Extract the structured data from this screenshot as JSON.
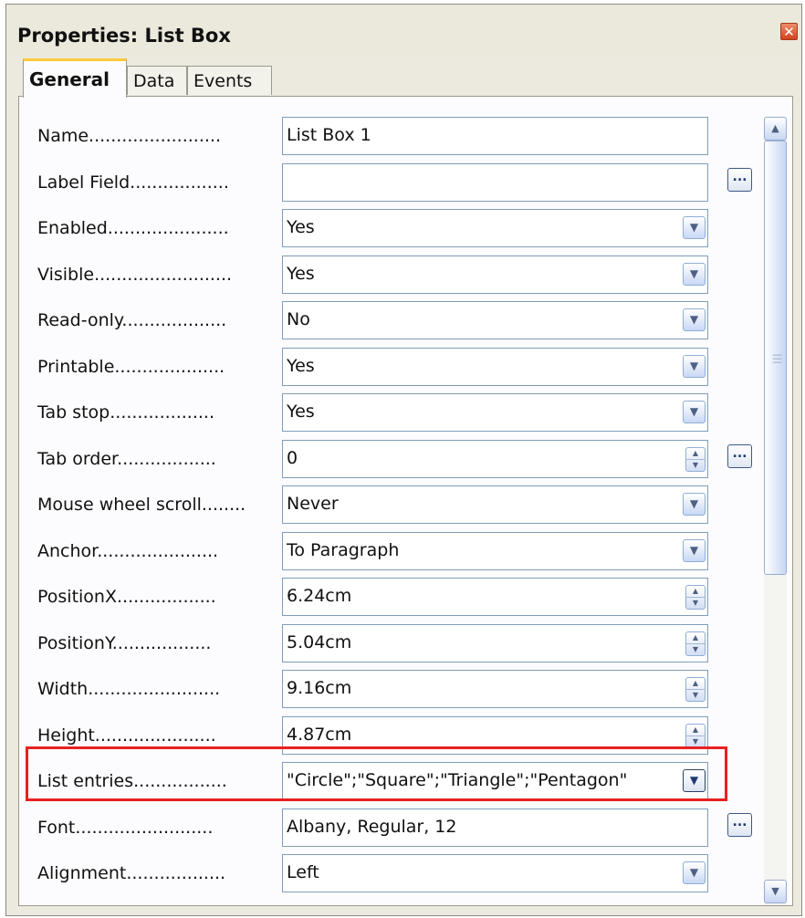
{
  "window": {
    "title": "Properties: List Box"
  },
  "tabs": [
    {
      "label": "General",
      "active": true
    },
    {
      "label": "Data",
      "active": false
    },
    {
      "label": "Events",
      "active": false
    }
  ],
  "properties": [
    {
      "label": "Name........................",
      "value": "List Box 1",
      "control": "text"
    },
    {
      "label": "Label Field..................",
      "value": "",
      "control": "text-ellipsis"
    },
    {
      "label": "Enabled......................",
      "value": "Yes",
      "control": "dropdown"
    },
    {
      "label": "Visible.........................",
      "value": "Yes",
      "control": "dropdown"
    },
    {
      "label": "Read-only...................",
      "value": "No",
      "control": "dropdown"
    },
    {
      "label": "Printable....................",
      "value": "Yes",
      "control": "dropdown"
    },
    {
      "label": "Tab stop...................",
      "value": "Yes",
      "control": "dropdown"
    },
    {
      "label": "Tab order..................",
      "value": "0",
      "control": "spin-ellipsis"
    },
    {
      "label": "Mouse wheel scroll........",
      "value": "Never",
      "control": "dropdown"
    },
    {
      "label": "Anchor......................",
      "value": "To Paragraph",
      "control": "dropdown"
    },
    {
      "label": "PositionX..................",
      "value": "6.24cm",
      "control": "spin"
    },
    {
      "label": "PositionY..................",
      "value": "5.04cm",
      "control": "spin"
    },
    {
      "label": "Width........................",
      "value": "9.16cm",
      "control": "spin"
    },
    {
      "label": "Height......................",
      "value": "4.87cm",
      "control": "spin"
    },
    {
      "label": "List entries.................",
      "value": "\"Circle\";\"Square\";\"Triangle\";\"Pentagon\"",
      "control": "dropdown-flat"
    },
    {
      "label": "Font.........................",
      "value": "Albany, Regular, 12",
      "control": "text-ellipsis"
    },
    {
      "label": "Alignment..................",
      "value": "Left",
      "control": "dropdown"
    }
  ],
  "colors": {
    "highlight": "#e82121",
    "tab_accent": "#ffc83c"
  }
}
